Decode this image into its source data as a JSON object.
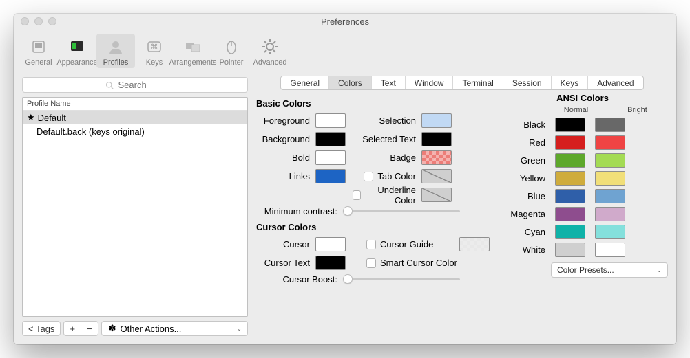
{
  "window": {
    "title": "Preferences"
  },
  "toolbar": {
    "items": [
      "General",
      "Appearance",
      "Profiles",
      "Keys",
      "Arrangements",
      "Pointer",
      "Advanced"
    ],
    "active": 2
  },
  "search": {
    "placeholder": "Search"
  },
  "profiles": {
    "header": "Profile Name",
    "rows": [
      {
        "star": true,
        "name": "Default",
        "selected": true
      },
      {
        "star": false,
        "name": "Default.back (keys original)",
        "selected": false
      }
    ],
    "footer": {
      "tags": "< Tags",
      "plus": "+",
      "minus": "−",
      "other": "Other Actions..."
    }
  },
  "detail_tabs": {
    "items": [
      "General",
      "Colors",
      "Text",
      "Window",
      "Terminal",
      "Session",
      "Keys",
      "Advanced"
    ],
    "active": 1
  },
  "sections": {
    "basic": "Basic Colors",
    "cursor": "Cursor Colors",
    "ansi": "ANSI Colors"
  },
  "basic_left": [
    {
      "label": "Foreground",
      "color": "#ffffff"
    },
    {
      "label": "Background",
      "color": "#000000"
    },
    {
      "label": "Bold",
      "color": "#ffffff"
    },
    {
      "label": "Links",
      "color": "#1d64c4"
    }
  ],
  "basic_right": [
    {
      "label": "Selection",
      "color": "#c1d9f4",
      "checkbox": false,
      "disabled": false
    },
    {
      "label": "Selected Text",
      "color": "#000000",
      "checkbox": false,
      "disabled": false
    },
    {
      "label": "Badge",
      "color": "#ec7d78",
      "checkbox": false,
      "disabled": false,
      "checker": true
    },
    {
      "label": "Tab Color",
      "disabled": true,
      "checkbox": true
    },
    {
      "label": "Underline Color",
      "disabled": true,
      "checkbox": true
    }
  ],
  "min_contrast": "Minimum contrast:",
  "cursor_left": [
    {
      "label": "Cursor",
      "color": "#ffffff"
    },
    {
      "label": "Cursor Text",
      "color": "#000000"
    }
  ],
  "cursor_right": [
    {
      "label": "Cursor Guide",
      "checker": true,
      "checkbox": true
    },
    {
      "label": "Smart Cursor Color",
      "no_swatch": true,
      "checkbox": true
    }
  ],
  "cursor_boost": "Cursor Boost:",
  "ansi": {
    "normal_h": "Normal",
    "bright_h": "Bright",
    "rows": [
      {
        "name": "Black",
        "n": "#000000",
        "b": "#686868"
      },
      {
        "name": "Red",
        "n": "#d51f1e",
        "b": "#ef4444"
      },
      {
        "name": "Green",
        "n": "#5ea82b",
        "b": "#a4db54"
      },
      {
        "name": "Yellow",
        "n": "#cfac3c",
        "b": "#f1df79"
      },
      {
        "name": "Blue",
        "n": "#2f5fa9",
        "b": "#6fa3d1"
      },
      {
        "name": "Magenta",
        "n": "#8e4d8e",
        "b": "#d0aacb"
      },
      {
        "name": "Cyan",
        "n": "#0fb2a8",
        "b": "#84e0dc"
      },
      {
        "name": "White",
        "n": "#cfcfcf",
        "b": "#ffffff"
      }
    ]
  },
  "presets_label": "Color Presets..."
}
